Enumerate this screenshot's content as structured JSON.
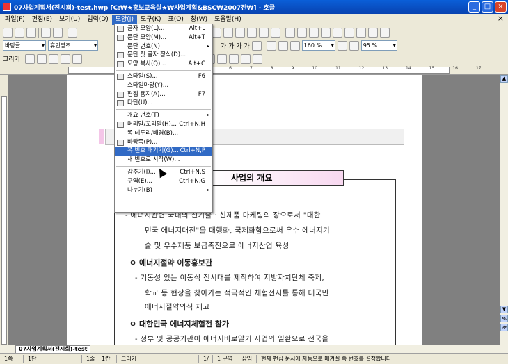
{
  "window": {
    "title": "07사업계획서(전시회)-test.hwp [C:₩★홍보교육실★₩사업계획&BSC₩2007전₩] - 호글",
    "buttons": [
      "_",
      "□",
      "×"
    ]
  },
  "menubar": {
    "items": [
      "파일(F)",
      "편집(E)",
      "보기(U)",
      "입력(D)",
      "모양(J)",
      "도구(K)",
      "표(O)",
      "창(W)",
      "도움말(H)"
    ],
    "active_index": 4,
    "close": "×"
  },
  "toolbar2": {
    "style_combo": "바탕글",
    "font_combo": "휴먼명조",
    "zoom_combo": "160 %",
    "font_style_chars": "가 가 가 가",
    "line_spacing_combo": "95 %"
  },
  "toolbar3": {
    "label": "그리기"
  },
  "ruler": {
    "numbers": [
      "1",
      "2",
      "3",
      "4",
      "5",
      "6",
      "7",
      "8",
      "9",
      "10",
      "11",
      "12",
      "13",
      "14",
      "15",
      "16",
      "17"
    ]
  },
  "dropdown": {
    "items": [
      {
        "label": "글자 모양(L)...",
        "shortcut": "Alt+L"
      },
      {
        "label": "문단 모양(M)...",
        "shortcut": "Alt+T"
      },
      {
        "label": "문단 번호(N)",
        "shortcut": "",
        "submenu": "▸"
      },
      {
        "label": "문단 첫 글자 장식(D)...",
        "shortcut": ""
      },
      {
        "label": "모양 복사(Q)...",
        "shortcut": "Alt+C"
      },
      {
        "sep": true
      },
      {
        "label": "스타일(S)...",
        "shortcut": "F6"
      },
      {
        "label": "스타일마당(Y)...",
        "shortcut": ""
      },
      {
        "label": "편집 용지(A)...",
        "shortcut": "F7"
      },
      {
        "label": "다단(U)...",
        "shortcut": ""
      },
      {
        "sep": true
      },
      {
        "label": "개요 번호(T)",
        "shortcut": "",
        "submenu": "▸"
      },
      {
        "label": "머리말/꼬리말(H)...",
        "shortcut": "Ctrl+N,H"
      },
      {
        "label": "쪽 테두리/배경(B)...",
        "shortcut": ""
      },
      {
        "label": "바탕쪽(P)...",
        "shortcut": ""
      },
      {
        "label": "쪽 번호 매기기(G)...",
        "shortcut": "Ctrl+N,P",
        "highlight": true
      },
      {
        "label": "새 번호로 시작(W)...",
        "shortcut": ""
      },
      {
        "sep": true
      },
      {
        "label": "감추기(I)...",
        "shortcut": "Ctrl+N,S"
      },
      {
        "label": "구역(E)...",
        "shortcut": "Ctrl+N,G"
      },
      {
        "label": "나누기(B)",
        "shortcut": "",
        "submenu": "▸"
      }
    ]
  },
  "document": {
    "title": "사업의 개요",
    "lines": [
      {
        "cls": "h",
        "text": "대전"
      },
      {
        "cls": "p",
        "text": "- 에너지관련 국내외 신기술 · 신제품 마케팅의 장으로서 \"대한"
      },
      {
        "cls": "p",
        "text": "민국 에너지대전\"을 대행화, 국제화함으로써 우수 에너지기"
      },
      {
        "cls": "p",
        "text": "술 및 우수제품 보급촉진으로 에너지산업 육성"
      },
      {
        "cls": "h",
        "text": "ㅇ 에너지절약 이동홍보관"
      },
      {
        "cls": "p",
        "text": "- 기동성 있는 이동식 전시대를 제작하여 지방자치단체 축제,"
      },
      {
        "cls": "p",
        "text": "학교 등 현장을 찾아가는 적극적인 체험전시를 통해 대국민"
      },
      {
        "cls": "p",
        "text": "에너지절약의식 제고"
      },
      {
        "cls": "h",
        "text": "ㅇ 대한민국 에너지체험전 참가"
      },
      {
        "cls": "p",
        "text": "- 정부 및 공공기관이 에너지바로알기 사업의 일환으로 전국을"
      }
    ]
  },
  "doctab": {
    "label": "07사업계획서(전시회)-test"
  },
  "statusbar": {
    "items": [
      "1쪽",
      "1단",
      "1줄",
      "1칸",
      "그리기",
      "1/",
      "1 구역",
      "삽입",
      "현재 편집 문서에 자동으로 매겨질 쪽 번호를 설정합니다."
    ]
  }
}
